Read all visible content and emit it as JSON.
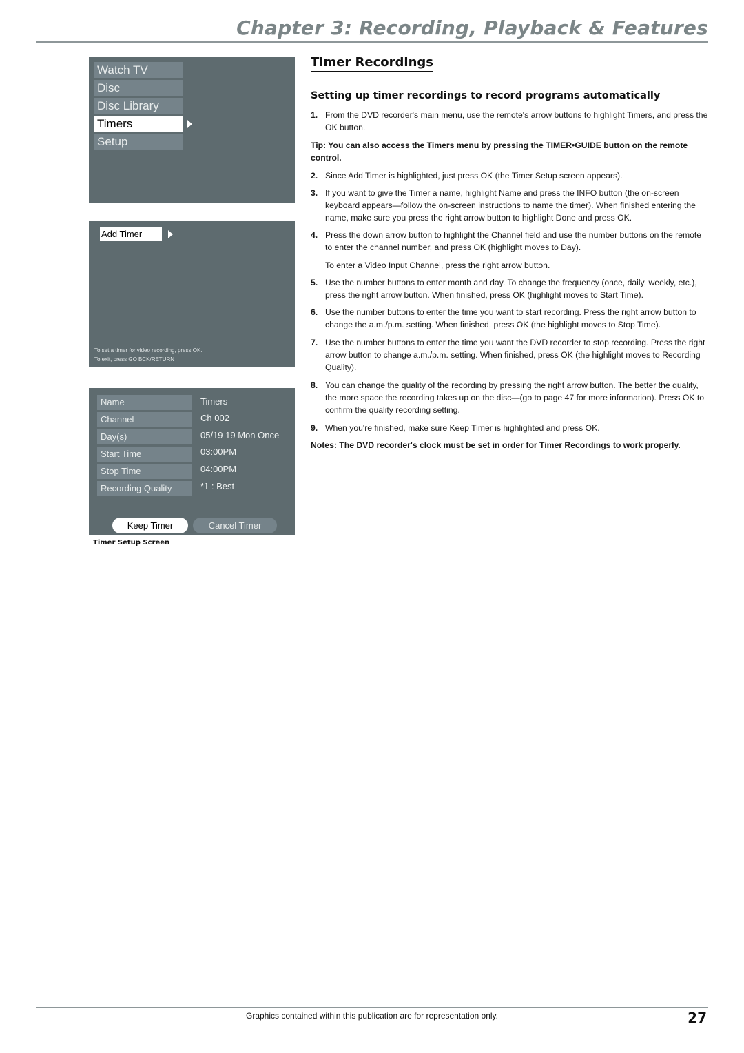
{
  "header": {
    "chapter_title": "Chapter 3: Recording, Playback & Features"
  },
  "main_menu_screen": {
    "items": [
      {
        "label": "Watch TV",
        "selected": false
      },
      {
        "label": "Disc",
        "selected": false
      },
      {
        "label": "Disc Library",
        "selected": false
      },
      {
        "label": "Timers",
        "selected": true
      },
      {
        "label": "Setup",
        "selected": false
      }
    ]
  },
  "timers_screen": {
    "add_timer_label": "Add Timer",
    "hint_line1": "To set a timer for video recording, press OK.",
    "hint_line2": "To exit, press GO BCK/RETURN"
  },
  "timer_setup_screen": {
    "fields": [
      {
        "label": "Name",
        "value": "Timers"
      },
      {
        "label": "Channel",
        "value": "Ch 002"
      },
      {
        "label": "Day(s)",
        "value": "05/19 19 Mon Once"
      },
      {
        "label": "Start Time",
        "value": "03:00PM"
      },
      {
        "label": "Stop Time",
        "value": "04:00PM"
      },
      {
        "label": "Recording Quality",
        "value": "*1 : Best"
      }
    ],
    "keep_button": "Keep Timer",
    "cancel_button": "Cancel Timer",
    "caption": "Timer Setup Screen"
  },
  "content": {
    "section_title": "Timer Recordings",
    "subheading": "Setting up timer recordings to record programs automatically",
    "step1_num": "1.",
    "step1": "From the DVD recorder's main menu, use the remote's arrow buttons to highlight Timers, and press the OK button.",
    "tip": "Tip: You can also access the Timers menu by pressing the TIMER•GUIDE button on the remote control.",
    "step2_num": "2.",
    "step2": "Since Add Timer is highlighted, just press OK (the Timer Setup screen appears).",
    "step3_num": "3.",
    "step3": "If you want to give the Timer a name, highlight Name and press the INFO button (the on-screen keyboard appears—follow the on-screen instructions to name the timer). When finished entering the name, make sure you press the right arrow button to highlight Done and press OK.",
    "step4_num": "4.",
    "step4": "Press the down arrow button to highlight the Channel field and use the number buttons on the remote to enter the channel number, and press OK (highlight moves to Day).",
    "step4_extra": "To enter a Video Input Channel, press the right arrow button.",
    "step5_num": "5.",
    "step5": "Use the number buttons to enter month and day. To change the frequency (once, daily, weekly, etc.), press the right arrow button. When finished, press OK (highlight moves to Start Time).",
    "step6_num": "6.",
    "step6": "Use the number buttons to enter the time you want to start recording. Press the right arrow button to change the a.m./p.m. setting. When finished, press OK (the highlight moves to Stop Time).",
    "step7_num": "7.",
    "step7": "Use the number buttons to enter the time you want the DVD recorder to stop recording. Press the right arrow button to change a.m./p.m. setting. When finished, press OK (the highlight moves to Recording Quality).",
    "step8_num": "8.",
    "step8": "You can change the quality of the recording by pressing the right arrow button. The better the quality, the more space the recording takes up on the disc—(go to page 47 for more information). Press OK to confirm the quality recording setting.",
    "step9_num": "9.",
    "step9": "When you're finished, make sure Keep Timer is highlighted and press OK.",
    "note": "Notes: The DVD recorder's clock must be set in order for Timer Recordings to work properly."
  },
  "footer": {
    "disclaimer": "Graphics contained within this publication are for representation only.",
    "page_number": "27"
  }
}
